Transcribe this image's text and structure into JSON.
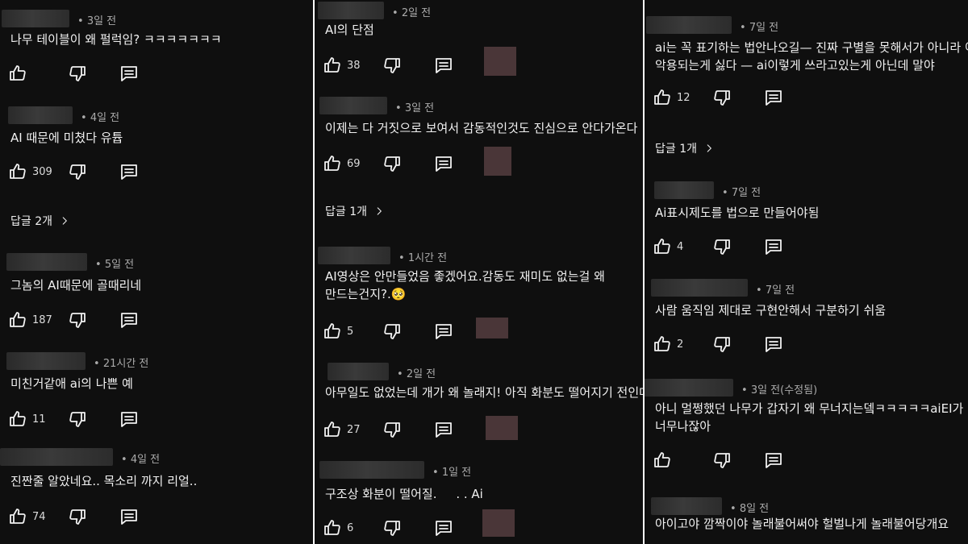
{
  "columns": [
    {
      "comments": [
        {
          "time": "3일 전",
          "text": "나무 테이블이 왜 펄럭임? ㅋㅋㅋㅋㅋㅋㅋ",
          "likes": "",
          "replies": ""
        },
        {
          "time": "4일 전",
          "text": "AI 때문에 미쳤다 유튭",
          "likes": "309",
          "replies": "답글 2개"
        },
        {
          "time": "5일 전",
          "text": "그놈의 AI때문에 골때리네",
          "likes": "187",
          "replies": ""
        },
        {
          "time": "21시간 전",
          "text": "미친거같애 ai의 나쁜 예",
          "likes": "11",
          "replies": ""
        },
        {
          "time": "4일 전",
          "text": "진짠줄 알았네요.. 목소리 까지 리얼..",
          "likes": "74",
          "replies": ""
        }
      ]
    },
    {
      "comments": [
        {
          "time": "2일 전",
          "text": "AI의 단점",
          "likes": "38",
          "replies": ""
        },
        {
          "time": "3일 전",
          "text": "이제는 다 거짓으로 보여서 감동적인것도 진심으로 안다가온다",
          "likes": "69",
          "replies": "답글 1개"
        },
        {
          "time": "1시간 전",
          "text": "AI영상은 안만들었음 좋겠어요.감동도 재미도 없는걸 왜\n만드는건지?.🥺",
          "likes": "5",
          "replies": ""
        },
        {
          "time": "2일 전",
          "text": "아무일도 없었는데 개가 왜 놀래지! 아직 화분도 떨어지기 전인데",
          "likes": "27",
          "replies": ""
        },
        {
          "time": "1일 전",
          "text": "구조상 화분이 떨어질.     . . Ai",
          "likes": "6",
          "replies": ""
        }
      ]
    },
    {
      "comments": [
        {
          "time": "7일 전",
          "text": "ai는 꼭 표기하는 법안나오길— 진짜 구별을 못해서가 아니라 이\n악용되는게 싫다 — ai이렇게 쓰라고있는게 아닌데 말야",
          "likes": "12",
          "replies": "답글 1개"
        },
        {
          "time": "7일 전",
          "text": "Ai표시제도를 법으로 만들어야됨",
          "likes": "4",
          "replies": ""
        },
        {
          "time": "7일 전",
          "text": "사람 움직임 제대로 구현안해서 구분하기 쉬움",
          "likes": "2",
          "replies": ""
        },
        {
          "time": "3일 전(수정됨)",
          "text": "아니 멀쩡했던 나무가 갑자기 왜 무너지는뎈ㅋㅋㅋㅋㅋaiEI가\n너무나잖아",
          "likes": "",
          "replies": ""
        },
        {
          "time": "8일 전",
          "text": "아이고야 깜짝이야 놀래불어써야 헐벌나게 놀래불어당개요",
          "likes": "",
          "replies": ""
        }
      ]
    }
  ],
  "icons": {
    "like": "thumb-up-icon",
    "dislike": "thumb-down-icon",
    "reply": "comment-icon",
    "chevron": "chevron-right-icon"
  },
  "colors": {
    "panel_bg": "#0f0f0f",
    "text": "#f1f1f1",
    "meta": "#aaaaaa"
  }
}
